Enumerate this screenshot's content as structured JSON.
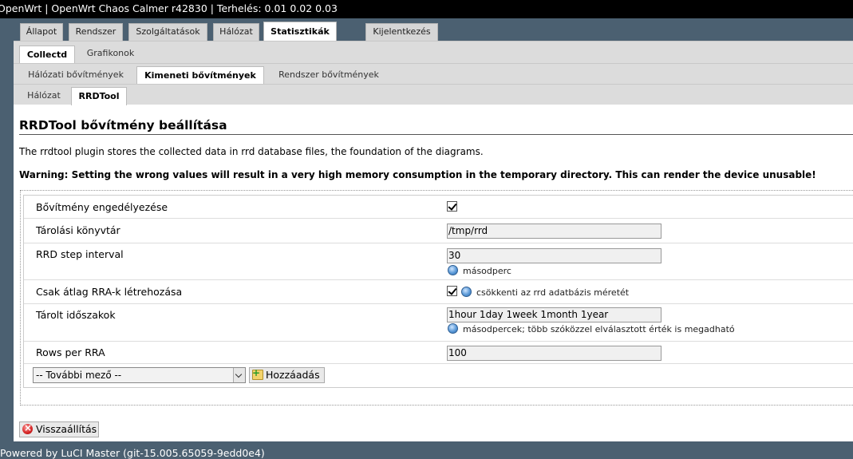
{
  "header": {
    "title": "OpenWrt | OpenWrt Chaos Calmer r42830 | Terhelés: 0.01 0.02 0.03"
  },
  "main_tabs": [
    {
      "label": "Állapot"
    },
    {
      "label": "Rendszer"
    },
    {
      "label": "Szolgáltatások"
    },
    {
      "label": "Hálózat"
    },
    {
      "label": "Statisztikák",
      "active": true
    },
    {
      "label": "Kijelentkezés"
    }
  ],
  "sub_tabs_1": [
    {
      "label": "Collectd",
      "active": true
    },
    {
      "label": "Grafikonok"
    }
  ],
  "sub_tabs_2": [
    {
      "label": "Hálózati bővítmények"
    },
    {
      "label": "Kimeneti bővítmények",
      "active": true
    },
    {
      "label": "Rendszer bővítmények"
    }
  ],
  "sub_tabs_3": [
    {
      "label": "Hálózat"
    },
    {
      "label": "RRDTool",
      "active": true
    }
  ],
  "page": {
    "title": "RRDTool bővítmény beállítása",
    "description": "The rrdtool plugin stores the collected data in rrd database files, the foundation of the diagrams.",
    "warning": "Warning: Setting the wrong values will result in a very high memory consumption in the temporary directory. This can render the device unusable!"
  },
  "form": {
    "enable_label": "Bővítmény engedélyezése",
    "enable_checked": true,
    "storage_label": "Tárolási könyvtár",
    "storage_value": "/tmp/rrd",
    "step_label": "RRD step interval",
    "step_value": "30",
    "step_hint": "másodperc",
    "avg_label": "Csak átlag RRA-k létrehozása",
    "avg_checked": true,
    "avg_hint": "csökkenti az rrd adatbázis méretét",
    "periods_label": "Tárolt időszakok",
    "periods_value": "1hour 1day 1week 1month 1year",
    "periods_hint": "másodpercek; több szóközzel elválasztott érték is megadható",
    "rows_label": "Rows per RRA",
    "rows_value": "100",
    "more_field_select": "-- További mező --",
    "add_button": "Hozzáadás",
    "reset_button": "Visszaállítás"
  },
  "footer": {
    "text": "Powered by LuCI Master (git-15.005.65059-9edd0e4)"
  }
}
